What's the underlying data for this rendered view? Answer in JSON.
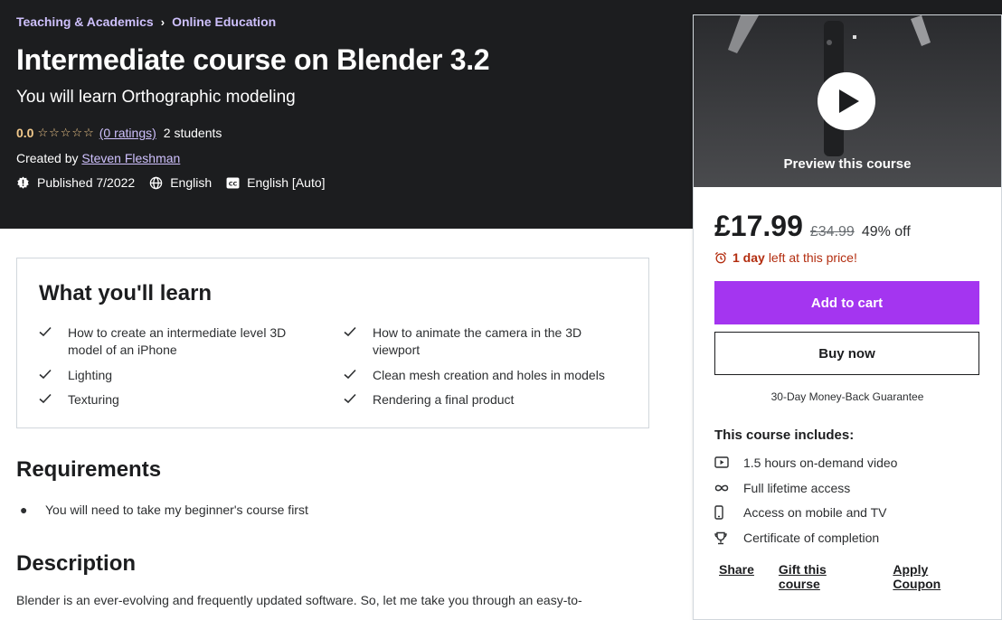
{
  "breadcrumb": {
    "category": "Teaching & Academics",
    "subcategory": "Online Education",
    "separator": "›"
  },
  "course": {
    "title": "Intermediate course on Blender 3.2",
    "subtitle": "You will learn Orthographic modeling",
    "rating": "0.0",
    "stars": "☆☆☆☆☆",
    "ratings_link": "(0 ratings)",
    "students": "2 students",
    "created_by_label": "Created by",
    "instructor": "Steven Fleshman",
    "published": "Published 7/2022",
    "language": "English",
    "captions": "English [Auto]"
  },
  "learn": {
    "title": "What you'll learn",
    "items": [
      "How to create an intermediate level 3D model of an iPhone",
      "How to animate the camera in the 3D viewport",
      "Lighting",
      "Clean mesh creation and holes in models",
      "Texturing",
      "Rendering a final product"
    ]
  },
  "requirements": {
    "title": "Requirements",
    "items": [
      "You will need to take my beginner's course first"
    ]
  },
  "description": {
    "title": "Description",
    "text": "Blender is an ever-evolving and frequently updated software.  So, let me take you through an easy-to-"
  },
  "sidebar": {
    "preview_label": "Preview this course",
    "price": "£17.99",
    "original_price": "£34.99",
    "discount": "49% off",
    "timer_bold": "1 day",
    "timer_rest": "left at this price!",
    "add_to_cart": "Add to cart",
    "buy_now": "Buy now",
    "guarantee": "30-Day Money-Back Guarantee",
    "includes_title": "This course includes:",
    "includes": [
      {
        "icon": "video-icon",
        "text": "1.5 hours on-demand video"
      },
      {
        "icon": "infinity-icon",
        "text": "Full lifetime access"
      },
      {
        "icon": "mobile-icon",
        "text": "Access on mobile and TV"
      },
      {
        "icon": "trophy-icon",
        "text": "Certificate of completion"
      }
    ],
    "links": {
      "share": "Share",
      "gift": "Gift this course",
      "coupon": "Apply Coupon"
    }
  },
  "colors": {
    "accent": "#a435f0",
    "hero_bg": "#1c1d1f",
    "link_purple": "#cec0fc",
    "star": "#f3ca8c",
    "alert": "#b32d0f"
  }
}
